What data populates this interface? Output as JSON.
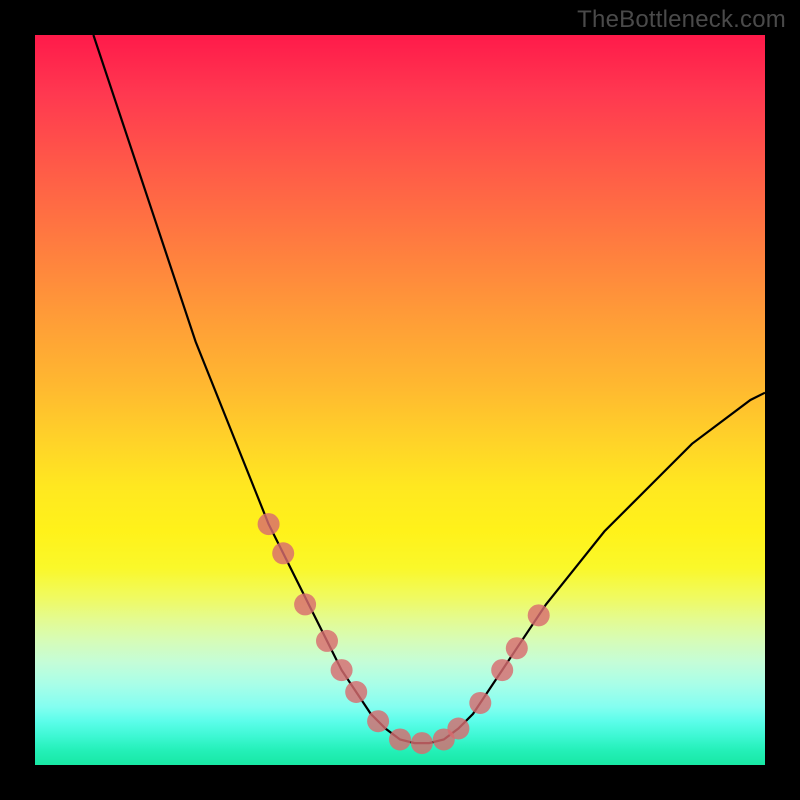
{
  "watermark": "TheBottleneck.com",
  "chart_data": {
    "type": "line",
    "title": "",
    "xlabel": "",
    "ylabel": "",
    "xlim": [
      0,
      100
    ],
    "ylim": [
      0,
      100
    ],
    "grid": false,
    "legend": false,
    "gradient_stops": [
      {
        "pos": 0.0,
        "color": "#ff1a4a"
      },
      {
        "pos": 0.3,
        "color": "#ff8a3c"
      },
      {
        "pos": 0.6,
        "color": "#ffe820"
      },
      {
        "pos": 0.8,
        "color": "#e4fb90"
      },
      {
        "pos": 1.0,
        "color": "#18e8a4"
      }
    ],
    "series": [
      {
        "name": "bottleneck-curve",
        "stroke": "#000000",
        "x": [
          8,
          10,
          12,
          14,
          16,
          18,
          20,
          22,
          24,
          26,
          28,
          30,
          32,
          34,
          36,
          38,
          40,
          42,
          44,
          46,
          48,
          50,
          52,
          54,
          56,
          58,
          60,
          62,
          64,
          66,
          68,
          70,
          74,
          78,
          82,
          86,
          90,
          94,
          98,
          100
        ],
        "y": [
          100,
          94,
          88,
          82,
          76,
          70,
          64,
          58,
          53,
          48,
          43,
          38,
          33,
          29,
          25,
          21,
          17,
          13,
          10,
          7,
          5,
          3.5,
          3,
          3,
          3.5,
          5,
          7,
          10,
          13,
          16,
          19,
          22,
          27,
          32,
          36,
          40,
          44,
          47,
          50,
          51
        ]
      }
    ],
    "markers": {
      "name": "highlighted-points",
      "color": "#d86b6f",
      "radius_px": 11,
      "x": [
        32,
        34,
        37,
        40,
        42,
        44,
        47,
        50,
        53,
        56,
        58,
        61,
        64,
        66,
        69
      ],
      "y": [
        33,
        29,
        22,
        17,
        13,
        10,
        6,
        3.5,
        3,
        3.5,
        5,
        8.5,
        13,
        16,
        20.5
      ]
    }
  }
}
